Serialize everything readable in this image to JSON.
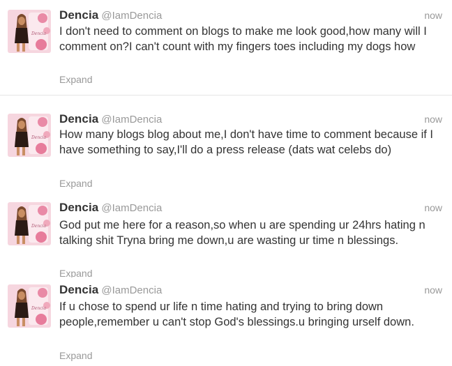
{
  "tweets": [
    {
      "name": "Dencia",
      "handle": "@IamDencia",
      "time": "now",
      "text": "I don't need to comment on blogs to make me look good,how many will I comment on?I can't count with my fingers toes including my dogs how",
      "action": "Expand"
    },
    {
      "name": "Dencia",
      "handle": "@IamDencia",
      "time": "now",
      "text": "How many blogs blog about me,I don't have time to comment because if I have something to say,I'll do a press release (dats wat celebs do)",
      "action": "Expand"
    },
    {
      "name": "Dencia",
      "handle": "@IamDencia",
      "time": "now",
      "text": "God put me here for a reason,so when u are spending ur 24hrs hating n talking shit Tryna bring me down,u are wasting ur time n blessings.",
      "action": "Expand"
    },
    {
      "name": "Dencia",
      "handle": "@IamDencia",
      "time": "now",
      "text": "If u chose to spend ur life n time hating and trying to bring down people,remember u can't stop God's blessings.u bringing urself down.",
      "action": "Expand"
    }
  ]
}
